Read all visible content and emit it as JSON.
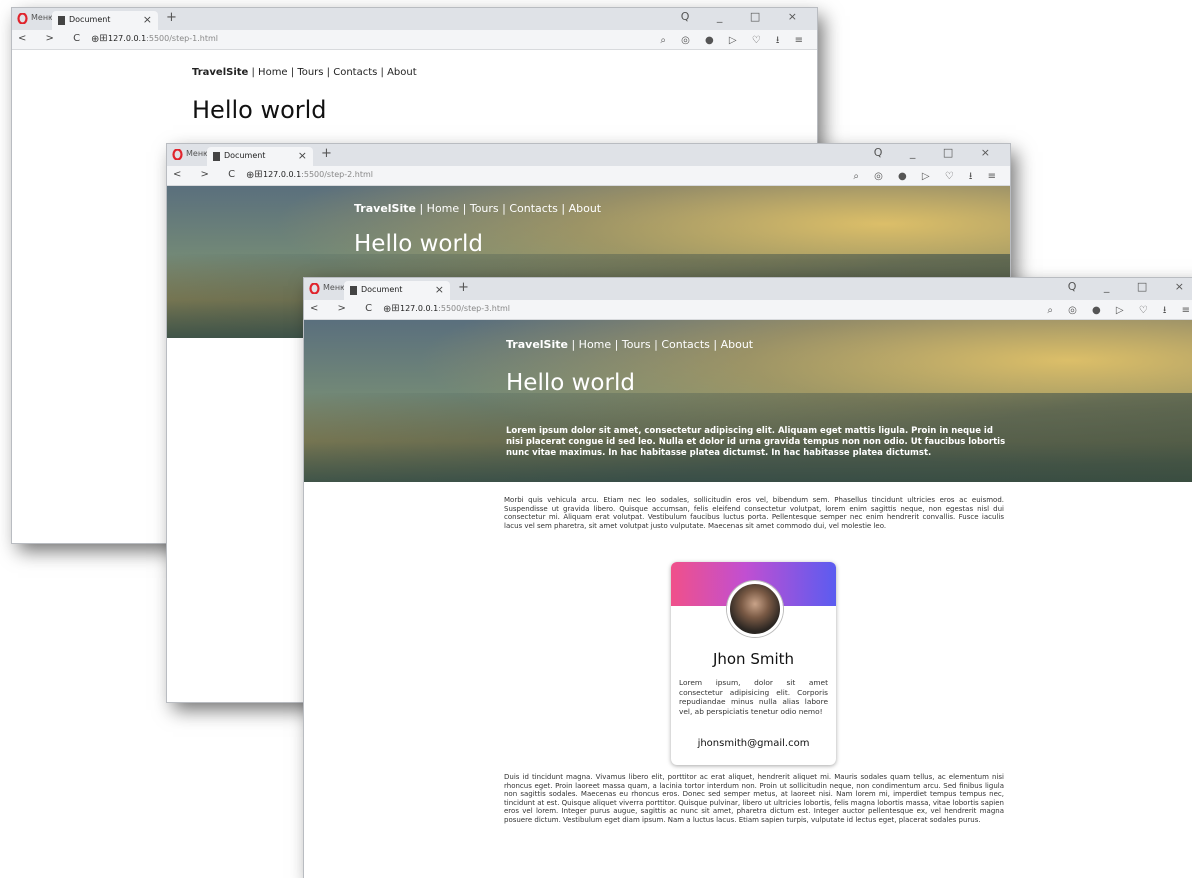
{
  "browser": {
    "menu_label": "Меню",
    "tab_title": "Document",
    "new_tab": "+",
    "window_controls": "Q _ □ ×",
    "nav_buttons": "< > C ⊞",
    "tools": "⌕ ◎ ● ▷ ♡ ⭳ ≡"
  },
  "windows": [
    {
      "url_host": "127.0.0.1",
      "url_rest": ":5500/step-1.html"
    },
    {
      "url_host": "127.0.0.1",
      "url_rest": ":5500/step-2.html"
    },
    {
      "url_host": "127.0.0.1",
      "url_rest": ":5500/step-3.html"
    }
  ],
  "site": {
    "brand": "TravelSite",
    "links": " | Home | Tours | Contacts | About",
    "heading": "Hello world",
    "hero_text": "Lorem ipsum dolor sit amet, consectetur adipiscing elit. Aliquam eget mattis ligula. Proin in neque id nisi placerat congue id sed leo. Nulla et dolor id urna gravida tempus non non odio. Ut faucibus lobortis nunc vitae maximus. In hac habitasse platea dictumst. In hac habitasse platea dictumst.",
    "paragraph_1": "Morbi quis vehicula arcu. Etiam nec leo sodales, sollicitudin eros vel, bibendum sem. Phasellus tincidunt ultricies eros ac euismod. Suspendisse ut gravida libero. Quisque accumsan, felis eleifend consectetur volutpat, lorem enim sagittis neque, non egestas nisl dui consectetur mi. Aliquam erat volutpat. Vestibulum faucibus luctus porta. Pellentesque semper nec enim hendrerit convallis. Fusce iaculis lacus vel sem pharetra, sit amet volutpat justo vulputate. Maecenas sit amet commodo dui, vel molestie leo.",
    "paragraph_2": "Duis id tincidunt magna. Vivamus libero elit, porttitor ac erat aliquet, hendrerit aliquet mi. Mauris sodales quam tellus, ac elementum nisi rhoncus eget. Proin laoreet massa quam, a lacinia tortor interdum non. Proin ut sollicitudin neque, non condimentum arcu. Sed finibus ligula non sagittis sodales. Maecenas eu rhoncus eros. Donec sed semper metus, at laoreet nisi. Nam lorem mi, imperdiet tempus tempus nec, tincidunt at est. Quisque aliquet viverra porttitor. Quisque pulvinar, libero ut ultricies lobortis, felis magna lobortis massa, vitae lobortis sapien eros vel lorem. Integer purus augue, sagittis ac nunc sit amet, pharetra dictum est. Integer auctor pellentesque ex, vel hendrerit magna posuere dictum. Vestibulum eget diam ipsum. Nam a luctus lacus. Etiam sapien turpis, vulputate id lectus eget, placerat sodales purus."
  },
  "card": {
    "name": "Jhon Smith",
    "bio": "Lorem ipsum, dolor sit amet consectetur adipisicing elit. Corporis repudiandae minus nulla alias labore vel, ab perspiciatis tenetur odio nemo!",
    "email": "jhonsmith@gmail.com"
  },
  "colors": {
    "card_gradient_start": "#f0508a",
    "card_gradient_end": "#5b5cf0",
    "hero_glow": "#e2c268"
  }
}
